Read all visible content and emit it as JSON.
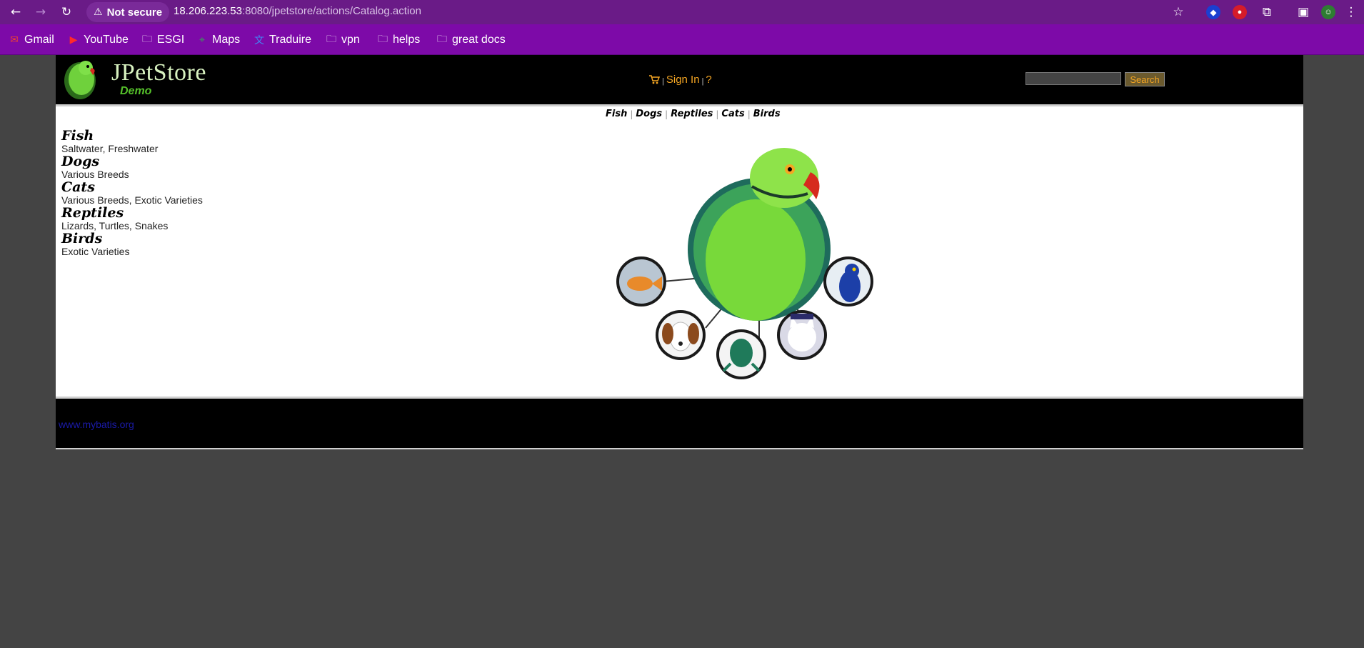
{
  "browser": {
    "security_label": "Not secure",
    "url_host": "18.206.223.53",
    "url_rest": ":8080/jpetstore/actions/Catalog.action",
    "bookmarks": [
      {
        "label": "Gmail",
        "icon": "gmail-icon"
      },
      {
        "label": "YouTube",
        "icon": "youtube-icon"
      },
      {
        "label": "ESGI",
        "icon": "folder-icon"
      },
      {
        "label": "Maps",
        "icon": "maps-icon"
      },
      {
        "label": "Traduire",
        "icon": "translate-icon"
      },
      {
        "label": "vpn",
        "icon": "folder-icon"
      },
      {
        "label": "helps",
        "icon": "folder-icon"
      },
      {
        "label": "great docs",
        "icon": "folder-icon"
      }
    ]
  },
  "header": {
    "logo_text": "JPetStore",
    "logo_subtext": "Demo",
    "sign_in": "Sign In",
    "help": "?",
    "search_button": "Search",
    "search_placeholder": ""
  },
  "quicklinks": [
    "Fish",
    "Dogs",
    "Reptiles",
    "Cats",
    "Birds"
  ],
  "sidebar": [
    {
      "title": "Fish",
      "desc": "Saltwater, Freshwater"
    },
    {
      "title": "Dogs",
      "desc": "Various Breeds"
    },
    {
      "title": "Cats",
      "desc": "Various Breeds, Exotic Varieties"
    },
    {
      "title": "Reptiles",
      "desc": "Lizards, Turtles, Snakes"
    },
    {
      "title": "Birds",
      "desc": "Exotic Varieties"
    }
  ],
  "footer": {
    "link": "www.mybatis.org"
  },
  "colors": {
    "chrome_toolbar": "#6a1b87",
    "bookmarks_bar": "#7d0aa8",
    "menu_accent": "#f5a623",
    "page_background": "#444444"
  }
}
